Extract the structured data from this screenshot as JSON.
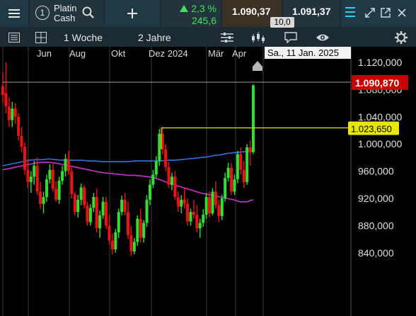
{
  "instrument": {
    "number": "1",
    "name_line1": "Platin",
    "name_line2": "Cash"
  },
  "quote": {
    "change_pct": "2,3 %",
    "change_abs": "245,6",
    "bid": "1.090,37",
    "ask": "1.091,37",
    "spread": "10,0",
    "arrow": "up-triangle"
  },
  "toolbar": {
    "period1": "1 Woche",
    "period2": "2 Jahre"
  },
  "icons": {
    "menu": "hamburger-icon",
    "search": "search-icon",
    "add": "plus-icon",
    "table": "list-icon",
    "grid": "grid-icon",
    "indicators": "sliders-icon",
    "candles": "candlestick-icon",
    "comment": "comment-icon",
    "eye": "eye-icon",
    "settings": "gear-icon",
    "win_tool": "checkbox-icon",
    "expand": "expand-icon",
    "popout": "popout-icon",
    "close": "close-icon"
  },
  "colors": {
    "up": "#33dd33",
    "down": "#ee1111",
    "ma_blue": "#2f6fe8",
    "ma_magenta": "#c832c8",
    "level": "#e8e800",
    "price_badge": "#c80000"
  },
  "chart_data": {
    "type": "candlestick",
    "x_labels": [
      "Jun",
      "Aug",
      "Okt",
      "Dez 2024",
      "Mär",
      "Apr"
    ],
    "y_ticks": [
      "1.120,000",
      "1.080,000",
      "1.040,000",
      "1.000,000",
      "960,000",
      "920,000",
      "880,000",
      "840,000"
    ],
    "ylim": [
      825,
      1125
    ],
    "tooltip": "Sa., 11 Jan. 2025",
    "current_price": "1.090,870",
    "level_price": "1.023,650",
    "current_value": 1090.87,
    "level_value": 1023.65,
    "grid": "vertical",
    "candles": [
      [
        1085,
        1105,
        1060,
        1072
      ],
      [
        1075,
        1120,
        1045,
        1055
      ],
      [
        1055,
        1068,
        1025,
        1035
      ],
      [
        1035,
        1062,
        1025,
        1052
      ],
      [
        1052,
        1060,
        1030,
        1040
      ],
      [
        1040,
        1045,
        1005,
        1012
      ],
      [
        1012,
        1025,
        988,
        996
      ],
      [
        996,
        1002,
        955,
        962
      ],
      [
        962,
        978,
        935,
        944
      ],
      [
        944,
        960,
        928,
        952
      ],
      [
        952,
        975,
        940,
        968
      ],
      [
        968,
        980,
        925,
        930
      ],
      [
        930,
        944,
        905,
        912
      ],
      [
        912,
        930,
        898,
        922
      ],
      [
        922,
        955,
        915,
        948
      ],
      [
        948,
        970,
        942,
        962
      ],
      [
        962,
        973,
        930,
        934
      ],
      [
        934,
        945,
        915,
        918
      ],
      [
        918,
        952,
        912,
        946
      ],
      [
        946,
        968,
        940,
        960
      ],
      [
        960,
        985,
        952,
        978
      ],
      [
        978,
        990,
        955,
        960
      ],
      [
        960,
        966,
        920,
        926
      ],
      [
        926,
        930,
        895,
        900
      ],
      [
        900,
        925,
        892,
        918
      ],
      [
        918,
        942,
        910,
        936
      ],
      [
        936,
        940,
        905,
        910
      ],
      [
        910,
        915,
        880,
        885
      ],
      [
        885,
        912,
        880,
        906
      ],
      [
        906,
        928,
        900,
        922
      ],
      [
        922,
        934,
        870,
        876
      ],
      [
        876,
        902,
        862,
        895
      ],
      [
        895,
        922,
        890,
        915
      ],
      [
        915,
        922,
        875,
        880
      ],
      [
        880,
        896,
        852,
        858
      ],
      [
        858,
        868,
        838,
        845
      ],
      [
        845,
        875,
        840,
        870
      ],
      [
        870,
        905,
        862,
        900
      ],
      [
        900,
        924,
        895,
        918
      ],
      [
        918,
        928,
        895,
        900
      ],
      [
        900,
        915,
        860,
        866
      ],
      [
        866,
        880,
        835,
        842
      ],
      [
        842,
        862,
        838,
        856
      ],
      [
        856,
        895,
        850,
        890
      ],
      [
        890,
        905,
        855,
        862
      ],
      [
        862,
        888,
        855,
        884
      ],
      [
        884,
        925,
        878,
        918
      ],
      [
        918,
        948,
        910,
        940
      ],
      [
        940,
        962,
        935,
        955
      ],
      [
        955,
        982,
        950,
        975
      ],
      [
        975,
        1022,
        968,
        1015
      ],
      [
        1015,
        1025,
        985,
        992
      ],
      [
        992,
        1000,
        960,
        966
      ],
      [
        966,
        974,
        935,
        940
      ],
      [
        940,
        958,
        932,
        952
      ],
      [
        952,
        960,
        918,
        922
      ],
      [
        922,
        930,
        900,
        908
      ],
      [
        908,
        925,
        898,
        918
      ],
      [
        918,
        935,
        905,
        912
      ],
      [
        912,
        920,
        880,
        886
      ],
      [
        886,
        905,
        880,
        900
      ],
      [
        900,
        918,
        890,
        896
      ],
      [
        896,
        910,
        870,
        876
      ],
      [
        876,
        890,
        862,
        884
      ],
      [
        884,
        904,
        878,
        896
      ],
      [
        896,
        928,
        890,
        922
      ],
      [
        922,
        930,
        892,
        898
      ],
      [
        898,
        935,
        895,
        930
      ],
      [
        930,
        945,
        905,
        910
      ],
      [
        910,
        918,
        885,
        894
      ],
      [
        894,
        925,
        888,
        920
      ],
      [
        920,
        958,
        915,
        950
      ],
      [
        950,
        972,
        945,
        965
      ],
      [
        965,
        972,
        925,
        930
      ],
      [
        930,
        955,
        925,
        948
      ],
      [
        948,
        990,
        942,
        985
      ],
      [
        985,
        995,
        955,
        962
      ],
      [
        962,
        975,
        935,
        944
      ],
      [
        944,
        1000,
        940,
        995
      ],
      [
        995,
        1005,
        968,
        988
      ],
      [
        988,
        1088,
        985,
        1086
      ]
    ],
    "ma_blue": [
      968,
      970,
      972,
      974,
      976,
      977,
      977,
      978,
      977,
      976,
      976,
      976,
      976,
      975,
      975,
      974,
      974,
      974,
      974,
      974,
      975,
      975,
      975,
      975,
      975,
      976,
      976,
      977,
      978,
      979,
      980,
      981,
      983,
      984,
      986,
      987,
      988,
      989,
      990
    ],
    "ma_magenta": [
      962,
      964,
      966,
      968,
      970,
      972,
      973,
      973,
      972,
      970,
      968,
      966,
      964,
      962,
      960,
      958,
      957,
      956,
      955,
      954,
      954,
      953,
      952,
      950,
      947,
      943,
      940,
      937,
      934,
      931,
      928,
      926,
      924,
      922,
      920,
      918,
      915,
      915,
      918
    ]
  }
}
